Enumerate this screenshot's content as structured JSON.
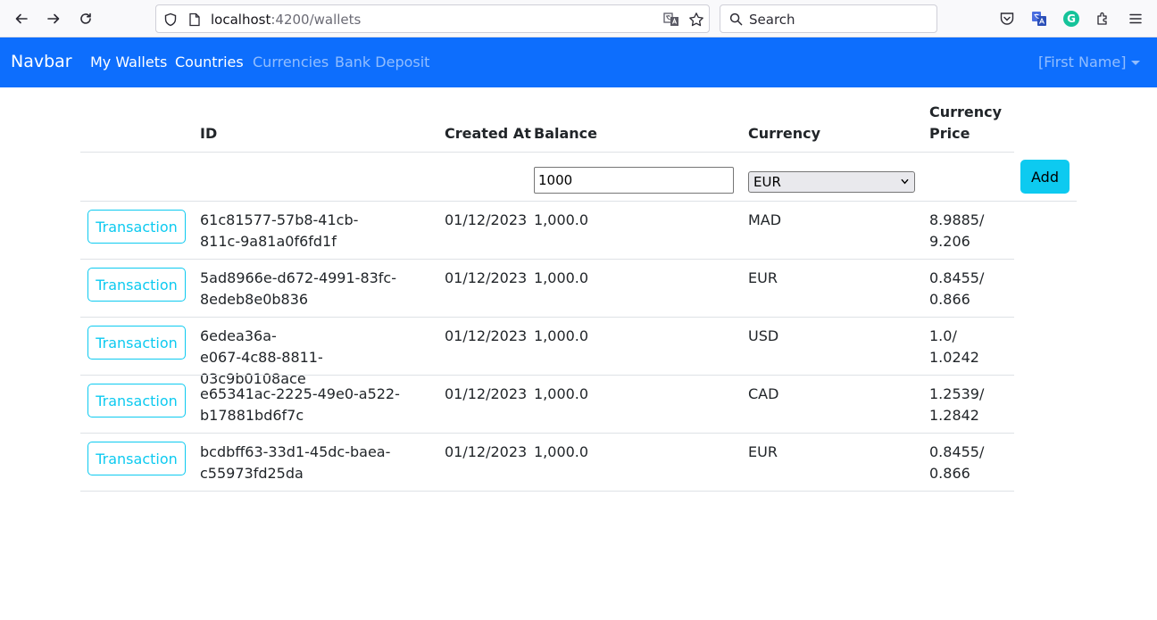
{
  "browser": {
    "url_host": "localhost",
    "url_path": ":4200/wallets",
    "search_placeholder": "Search"
  },
  "navbar": {
    "brand": "Navbar",
    "links": [
      {
        "label": "My Wallets",
        "state": "active"
      },
      {
        "label": "Countries",
        "state": "active"
      },
      {
        "label": "Currencies",
        "state": "muted"
      },
      {
        "label": "Bank Deposit",
        "state": "muted"
      }
    ],
    "user": "[First Name]"
  },
  "table": {
    "headers": {
      "id": "ID",
      "created_at": "Created At",
      "balance": "Balance",
      "currency": "Currency",
      "currency_price_line1": "Currency",
      "currency_price_line2": "Price"
    },
    "form": {
      "balance_value": "1000",
      "currency_selected": "EUR",
      "add_label": "Add"
    },
    "rows": [
      {
        "action": "Transaction",
        "id_line1": "61c81577-57b8-41cb-",
        "id_line2": "811c-9a81a0f6fd1f",
        "created_at": "01/12/2023",
        "balance": "1,000.0",
        "currency": "MAD",
        "price_line1": "8.9885/",
        "price_line2": "9.206"
      },
      {
        "action": "Transaction",
        "id_line1": "5ad8966e-d672-4991-83fc-",
        "id_line2": "8edeb8e0b836",
        "created_at": "01/12/2023",
        "balance": "1,000.0",
        "currency": "EUR",
        "price_line1": "0.8455/",
        "price_line2": "0.866"
      },
      {
        "action": "Transaction",
        "id_line1": "6edea36a-",
        "id_line2": "e067-4c88-8811-03c9b0108ace",
        "created_at": "01/12/2023",
        "balance": "1,000.0",
        "currency": "USD",
        "price_line1": "1.0/ 1.0242",
        "price_line2": ""
      },
      {
        "action": "Transaction",
        "id_line1": "e65341ac-2225-49e0-a522-",
        "id_line2": "b17881bd6f7c",
        "created_at": "01/12/2023",
        "balance": "1,000.0",
        "currency": "CAD",
        "price_line1": "1.2539/",
        "price_line2": "1.2842"
      },
      {
        "action": "Transaction",
        "id_line1": "bcdbff63-33d1-45dc-baea-",
        "id_line2": "c55973fd25da",
        "created_at": "01/12/2023",
        "balance": "1,000.0",
        "currency": "EUR",
        "price_line1": "0.8455/",
        "price_line2": "0.866"
      }
    ]
  },
  "colors": {
    "navbar_bg": "#0d6efd",
    "info": "#0dcaf0"
  }
}
